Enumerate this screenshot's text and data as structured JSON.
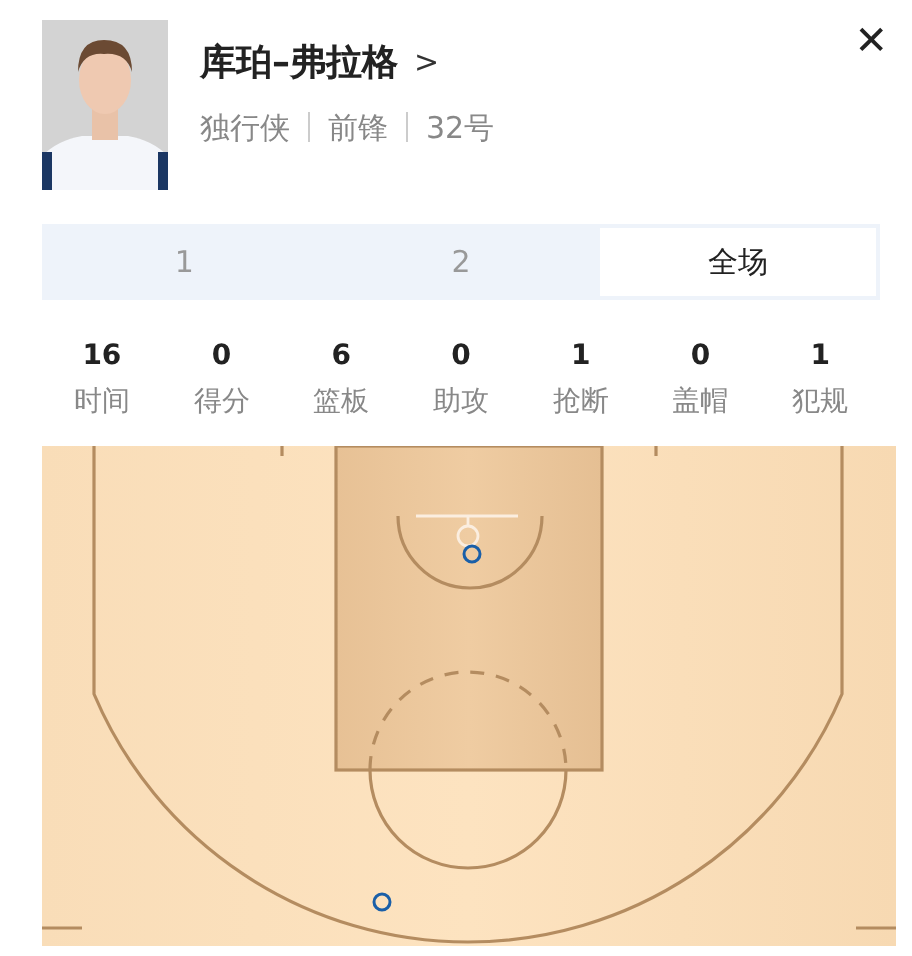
{
  "player": {
    "name": "库珀–弗拉格",
    "arrow": ">",
    "meta": [
      "独行侠",
      "前锋",
      "32号"
    ]
  },
  "close": "✕",
  "tabs": [
    {
      "label": "1",
      "selected": false
    },
    {
      "label": "2",
      "selected": false
    },
    {
      "label": "全场",
      "selected": true
    }
  ],
  "stats": [
    {
      "value": "16",
      "label": "时间"
    },
    {
      "value": "0",
      "label": "得分"
    },
    {
      "value": "6",
      "label": "篮板"
    },
    {
      "value": "0",
      "label": "助攻"
    },
    {
      "value": "1",
      "label": "抢断"
    },
    {
      "value": "0",
      "label": "盖帽"
    },
    {
      "value": "1",
      "label": "犯规"
    }
  ],
  "shots": [
    {
      "made": false
    },
    {
      "made": false
    }
  ]
}
